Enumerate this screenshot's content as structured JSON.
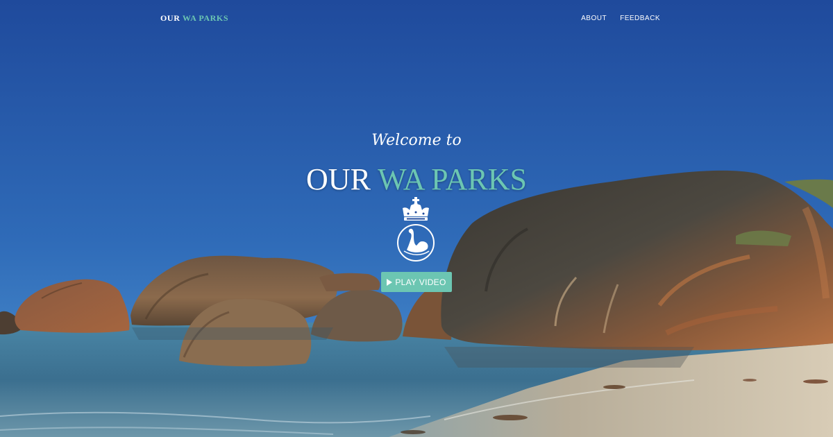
{
  "nav": {
    "brand_word1": "OUR",
    "brand_word2": "WA PARKS",
    "links": [
      "ABOUT",
      "FEEDBACK"
    ]
  },
  "hero": {
    "welcome": "Welcome to",
    "title_word1": "OUR",
    "title_word2": "WA PARKS",
    "play_label": "PLAY VIDEO",
    "crest_icon": "crown-swan-crest-icon"
  },
  "colors": {
    "accent": "#6cc6b2",
    "sky_top": "#1f4a9c",
    "sky_bottom": "#4a8fd0",
    "sea": "#3d7496",
    "sand": "#c9b9a0"
  }
}
